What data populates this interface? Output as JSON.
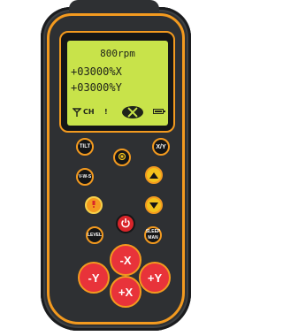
{
  "lcd": {
    "speed": "800rpm",
    "x_value": "+03000%X",
    "y_value": "+03000%Y",
    "channel": "CH",
    "alert": "!"
  },
  "buttons": {
    "tilt": "TILT",
    "xy": "X/Y",
    "vws": "V-W-S",
    "level": "LEVEL",
    "sleep": "SLEEP MAN",
    "minus_x": "-X",
    "plus_x": "+X",
    "minus_y": "-Y",
    "plus_y": "+Y"
  },
  "icons": {
    "signal": "antenna-icon",
    "eye": "crossed-eye-icon",
    "battery": "battery-icon",
    "scan": "scan-icon",
    "laser": "laser-icon",
    "power": "power-icon"
  },
  "colors": {
    "body": "#2e3033",
    "accent": "#f39a1f",
    "lcd": "#c8e34a",
    "red_pad": "#e8333a",
    "yellow": "#f3c21c"
  }
}
